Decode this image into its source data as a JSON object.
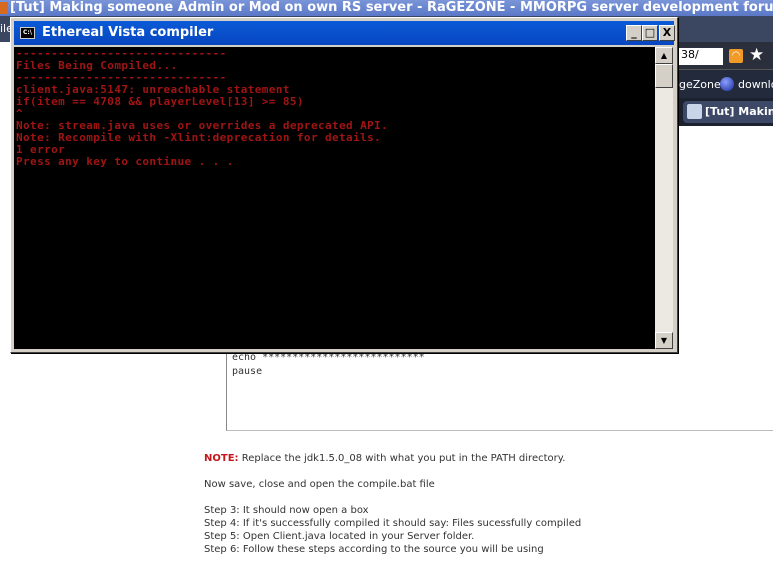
{
  "browser": {
    "title": "[Tut] Making someone Admin or Mod on own RS server - RaGEZONE - MMORPG server development forums - Mozilla Firefox",
    "menu_file": "ile",
    "url_fragment": "38/",
    "bookmark_1": "geZone",
    "bookmark_2": "downlo",
    "tab_label": "[Tut] Makin"
  },
  "console": {
    "title": "Ethereal Vista compiler",
    "icon_label": "C:\\",
    "minimize": "_",
    "maximize": "□",
    "close": "X",
    "lines": [
      "------------------------------",
      "Files Being Compiled...",
      "------------------------------",
      "client.java:5147: unreachable statement",
      "if(item == 4708 && playerLevel[13] >= 85)",
      "^",
      "Note: stream.java uses or overrides a deprecated API.",
      "Note: Recompile with -Xlint:deprecation for details.",
      "1 error",
      "Press any key to continue . . ."
    ]
  },
  "code_box": {
    "lines": [
      "echo ***************************",
      "pause"
    ]
  },
  "post": {
    "note_label": "NOTE:",
    "note_text": " Replace the jdk1.5.0_08 with what you put in the PATH directory.",
    "save_text": "Now save, close and open the compile.bat file",
    "steps": [
      "Step 3: It should now open a box",
      "Step 4: If it's successfully compiled it should say: Files sucessfully compiled",
      "Step 5: Open Client.java located in your Server folder.",
      "Step 6: Follow these steps according to the source you will be using"
    ]
  }
}
